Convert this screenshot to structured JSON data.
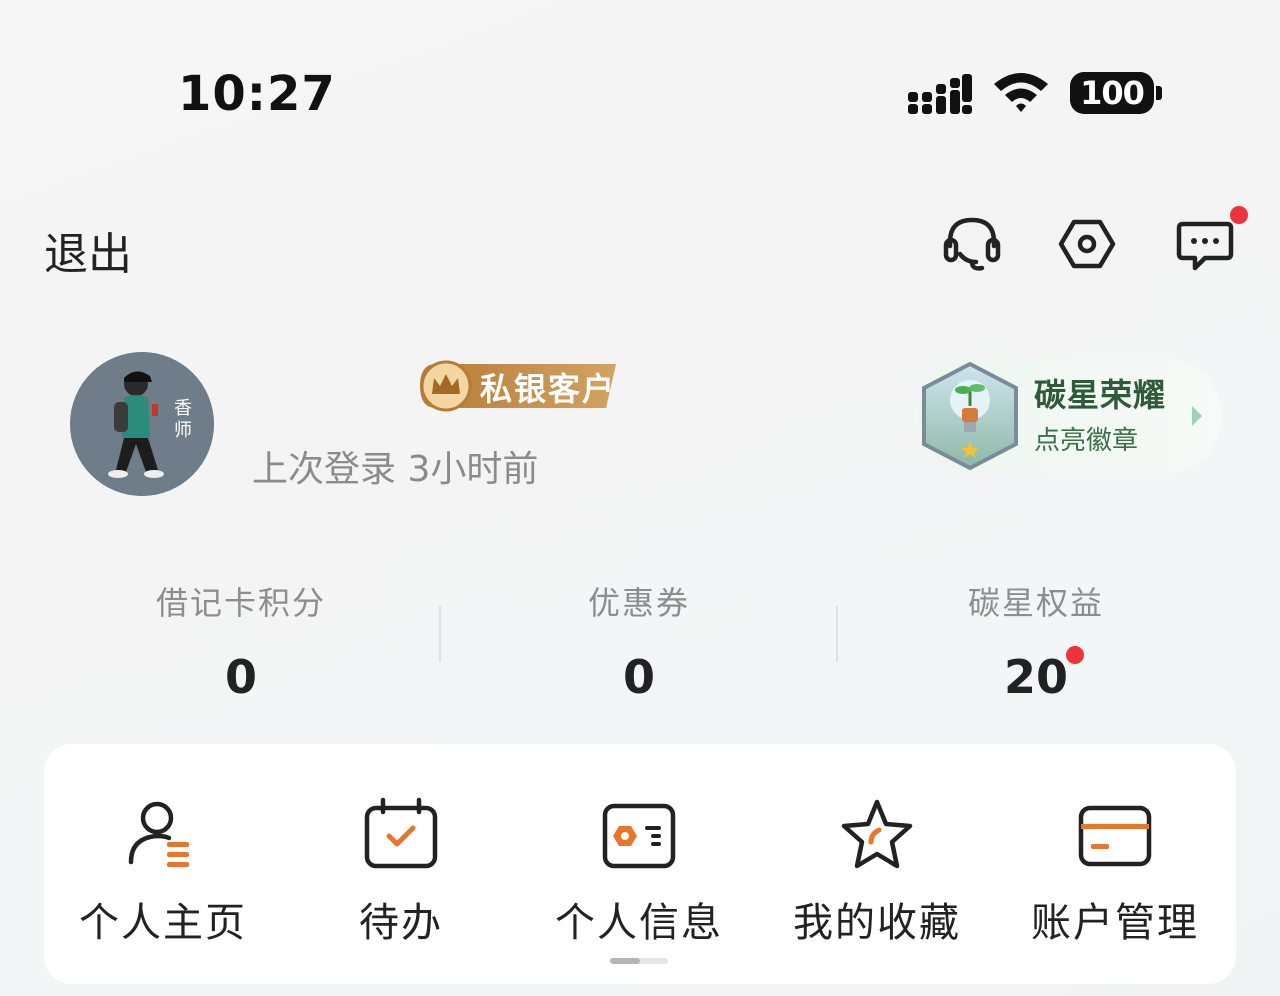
{
  "status_bar": {
    "time": "10:27",
    "battery": "100"
  },
  "header": {
    "logout_label": "退出",
    "icons": [
      "headset-icon",
      "settings-icon",
      "message-icon"
    ]
  },
  "profile": {
    "avatar_caption": "香师",
    "badge_label": "私银客户",
    "last_login": "上次登录 3小时前"
  },
  "honor": {
    "title": "碳星荣耀",
    "subtitle": "点亮徽章"
  },
  "stats": [
    {
      "label": "借记卡积分",
      "value": "0"
    },
    {
      "label": "优惠券",
      "value": "0"
    },
    {
      "label": "碳星权益",
      "value": "20"
    }
  ],
  "shortcuts": [
    {
      "label": "个人主页",
      "icon": "profile-icon"
    },
    {
      "label": "待办",
      "icon": "calendar-check-icon"
    },
    {
      "label": "个人信息",
      "icon": "id-card-icon"
    },
    {
      "label": "我的收藏",
      "icon": "star-icon"
    },
    {
      "label": "账户管理",
      "icon": "card-icon"
    }
  ],
  "colors": {
    "accent": "#e8772e",
    "notification": "#f0323c",
    "honor_green": "#2e5a3a",
    "badge_gold": "#c08a3e"
  }
}
